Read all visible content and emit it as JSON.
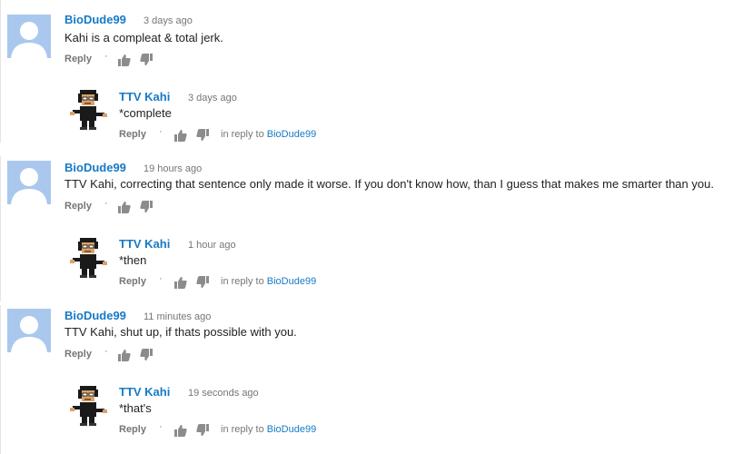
{
  "comments": [
    {
      "author": "BioDude99",
      "time": "3 days ago",
      "text": "Kahi is a compleat & total jerk.",
      "reply_label": "Reply"
    },
    {
      "author": "TTV Kahi",
      "time": "3 days ago",
      "text": "*complete",
      "reply_label": "Reply",
      "in_reply_prefix": "in reply to",
      "in_reply_to": "BioDude99"
    },
    {
      "author": "BioDude99",
      "time": "19 hours ago",
      "text": "TTV Kahi, correcting that sentence only made it worse. If you don't know how, than I guess that makes me smarter than you.",
      "reply_label": "Reply"
    },
    {
      "author": "TTV Kahi",
      "time": "1 hour ago",
      "text": "*then",
      "reply_label": "Reply",
      "in_reply_prefix": "in reply to",
      "in_reply_to": "BioDude99"
    },
    {
      "author": "BioDude99",
      "time": "11 minutes ago",
      "text": "TTV Kahi, shut up, if thats possible with you.",
      "reply_label": "Reply"
    },
    {
      "author": "TTV Kahi",
      "time": "19 seconds ago",
      "text": "*that's",
      "reply_label": "Reply",
      "in_reply_prefix": "in reply to",
      "in_reply_to": "BioDude99"
    }
  ],
  "icons": {
    "default_avatar": "default-avatar-silhouette",
    "pixel_avatar": "pixel-character-avatar",
    "like": "thumbs-up-icon",
    "dislike": "thumbs-down-icon"
  },
  "colors": {
    "author_link": "#167ac6",
    "meta_text": "#767676",
    "default_avatar_bg": "#aac8ee"
  }
}
